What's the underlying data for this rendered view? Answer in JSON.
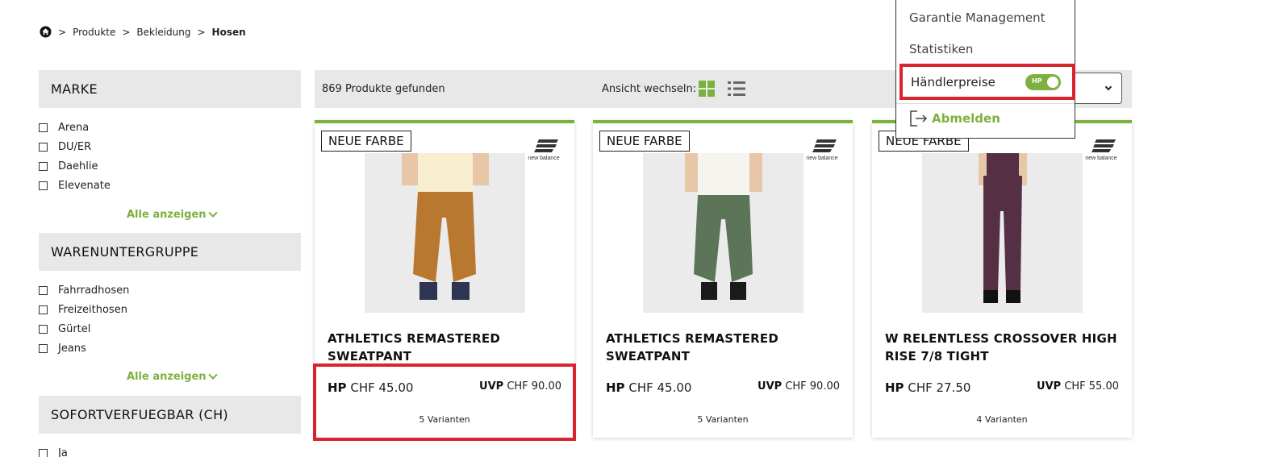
{
  "breadcrumb": {
    "items": [
      "Produkte",
      "Bekleidung"
    ],
    "current": "Hosen",
    "separator": ">"
  },
  "filters": [
    {
      "title": "MARKE",
      "options": [
        "Arena",
        "DU/ER",
        "Daehlie",
        "Elevenate"
      ],
      "show_all": "Alle anzeigen"
    },
    {
      "title": "WARENUNTERGRUPPE",
      "options": [
        "Fahrradhosen",
        "Freizeithosen",
        "Gürtel",
        "Jeans"
      ],
      "show_all": "Alle anzeigen"
    },
    {
      "title": "SOFORTVERFUEGBAR (CH)",
      "options": [
        "Ja"
      ]
    }
  ],
  "toolbar": {
    "count_text": "869 Produkte gefunden",
    "view_label": "Ansicht wechseln:",
    "active_view": "grid"
  },
  "products": [
    {
      "badge": "NEUE FARBE",
      "brand": "new balance",
      "title": "ATHLETICS REMASTERED SWEATPANT",
      "hp_label": "HP",
      "hp_price": "CHF 45.00",
      "uvp_label": "UVP",
      "uvp_price": "CHF 90.00",
      "variants": "5 Varianten",
      "color": "#b9782f"
    },
    {
      "badge": "NEUE FARBE",
      "brand": "new balance",
      "title": "ATHLETICS REMASTERED SWEATPANT",
      "hp_label": "HP",
      "hp_price": "CHF 45.00",
      "uvp_label": "UVP",
      "uvp_price": "CHF 90.00",
      "variants": "5 Varianten",
      "color": "#5c7457"
    },
    {
      "badge": "NEUE FARBE",
      "brand": "new balance",
      "title": "W RELENTLESS CROSSOVER HIGH RISE 7/8 TIGHT",
      "hp_label": "HP",
      "hp_price": "CHF 27.50",
      "uvp_label": "UVP",
      "uvp_price": "CHF 55.00",
      "variants": "4 Varianten",
      "color": "#553044"
    }
  ],
  "user_menu": {
    "items": [
      "Garantie Management",
      "Statistiken"
    ],
    "dealer_prices": {
      "label": "Händlerpreise",
      "toggle_text": "HP",
      "enabled": true
    },
    "logout": "Abmelden"
  },
  "colors": {
    "accent": "#7db13f",
    "highlight": "#d8242f",
    "panel": "#e8e8e8"
  }
}
